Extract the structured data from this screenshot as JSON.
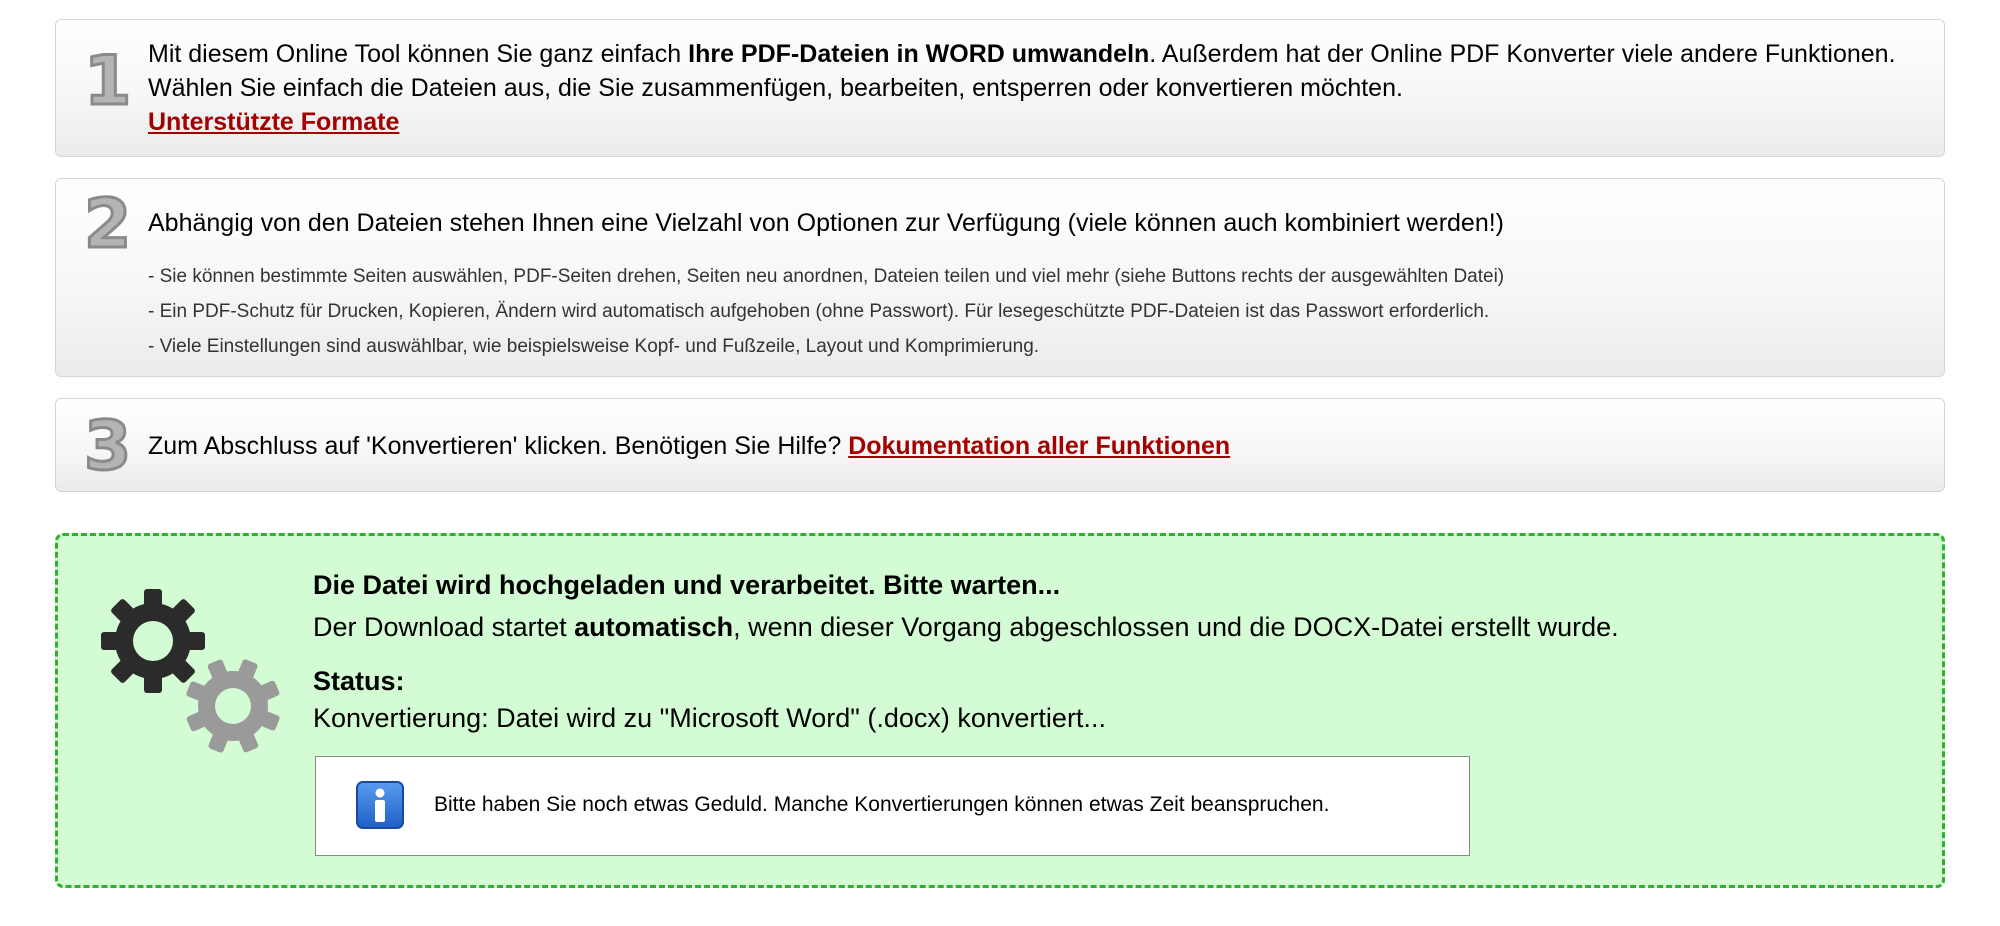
{
  "steps": [
    {
      "number": "1",
      "text_pre": "Mit diesem Online Tool können Sie ganz einfach ",
      "text_bold": "Ihre PDF-Dateien in WORD umwandeln",
      "text_post": ". Außerdem hat der Online PDF Konverter viele andere Funktionen. Wählen Sie einfach die Dateien aus, die Sie zusammenfügen, bearbeiten, entsperren oder konvertieren möchten.",
      "link": "Unterstützte Formate"
    },
    {
      "number": "2",
      "text": "Abhängig von den Dateien stehen Ihnen eine Vielzahl von Optionen zur Verfügung (viele können auch kombiniert werden!)",
      "bullets": [
        "- Sie können bestimmte Seiten auswählen, PDF-Seiten drehen, Seiten neu anordnen, Dateien teilen und viel mehr (siehe Buttons rechts der ausgewählten Datei)",
        "- Ein PDF-Schutz für Drucken, Kopieren, Ändern wird automatisch aufgehoben (ohne Passwort). Für lesegeschützte PDF-Dateien ist das Passwort erforderlich.",
        "- Viele Einstellungen sind auswählbar, wie beispielsweise Kopf- und Fußzeile, Layout und Komprimierung."
      ]
    },
    {
      "number": "3",
      "text": "Zum Abschluss auf 'Konvertieren' klicken. Benötigen Sie Hilfe? ",
      "link": "Dokumentation aller Funktionen"
    }
  ],
  "processing": {
    "heading": "Die Datei wird hochgeladen und verarbeitet. Bitte warten...",
    "line_pre": "Der Download startet ",
    "line_bold": "automatisch",
    "line_post": ", wenn dieser Vorgang abgeschlossen und die DOCX-Datei erstellt wurde.",
    "status_label": "Status:",
    "status_value": "Konvertierung: Datei wird zu \"Microsoft Word\" (.docx) konvertiert...",
    "info": "Bitte haben Sie noch etwas Geduld. Manche Konvertierungen können etwas Zeit beanspruchen.",
    "icons": [
      "gears-icon",
      "info-icon"
    ]
  },
  "colors": {
    "link": "#a50000",
    "status_bg": "#d4fcd4",
    "status_border": "#2fb12f",
    "gear_dark": "#2b2b2b",
    "gear_light": "#9a9a9a",
    "info_blue": "#1f5fc7"
  }
}
